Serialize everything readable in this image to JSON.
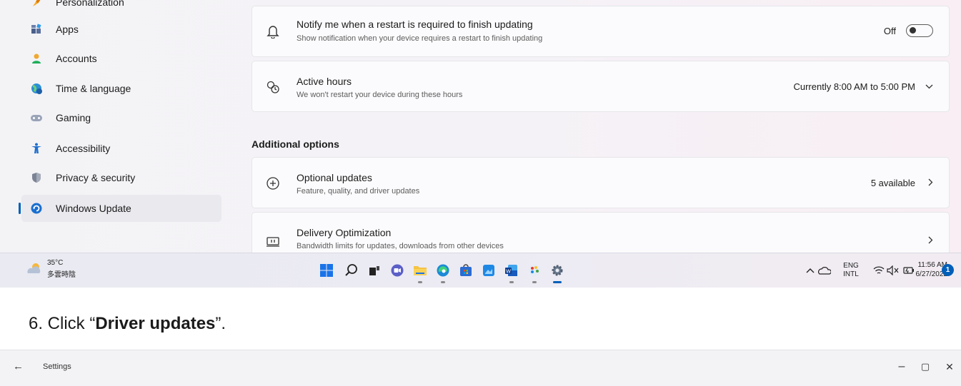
{
  "sidebar": {
    "items": [
      {
        "label": "Personalization",
        "icon": "brush-icon"
      },
      {
        "label": "Apps",
        "icon": "apps-icon"
      },
      {
        "label": "Accounts",
        "icon": "person-icon"
      },
      {
        "label": "Time & language",
        "icon": "globe-clock-icon"
      },
      {
        "label": "Gaming",
        "icon": "gamepad-icon"
      },
      {
        "label": "Accessibility",
        "icon": "accessibility-icon"
      },
      {
        "label": "Privacy & security",
        "icon": "shield-icon"
      },
      {
        "label": "Windows Update",
        "icon": "update-icon",
        "active": true
      }
    ]
  },
  "main": {
    "notify": {
      "title": "Notify me when a restart is required to finish updating",
      "subtitle": "Show notification when your device requires a restart to finish updating",
      "toggle_label": "Off",
      "toggle_on": false
    },
    "active_hours": {
      "title": "Active hours",
      "subtitle": "We won't restart your device during these hours",
      "value": "Currently 8:00 AM to 5:00 PM"
    },
    "section_heading": "Additional options",
    "optional_updates": {
      "title": "Optional updates",
      "subtitle": "Feature, quality, and driver updates",
      "value": "5 available"
    },
    "delivery_optimization": {
      "title": "Delivery Optimization",
      "subtitle": "Bandwidth limits for updates, downloads from other devices"
    }
  },
  "taskbar": {
    "weather_temp": "35°C",
    "weather_desc": "多雲時陰",
    "lang_top": "ENG",
    "lang_bottom": "INTL",
    "time": "11:56 AM",
    "date": "6/27/2022",
    "notification_count": "1",
    "accent": "#005fb8"
  },
  "instruction": {
    "prefix": "6.  Click “",
    "bold": "Driver updates",
    "suffix": "”."
  },
  "window2": {
    "title": "Settings",
    "minimize_glyph": "–",
    "maximize_glyph": "▢",
    "close_glyph": "✕",
    "back_glyph": "←"
  }
}
